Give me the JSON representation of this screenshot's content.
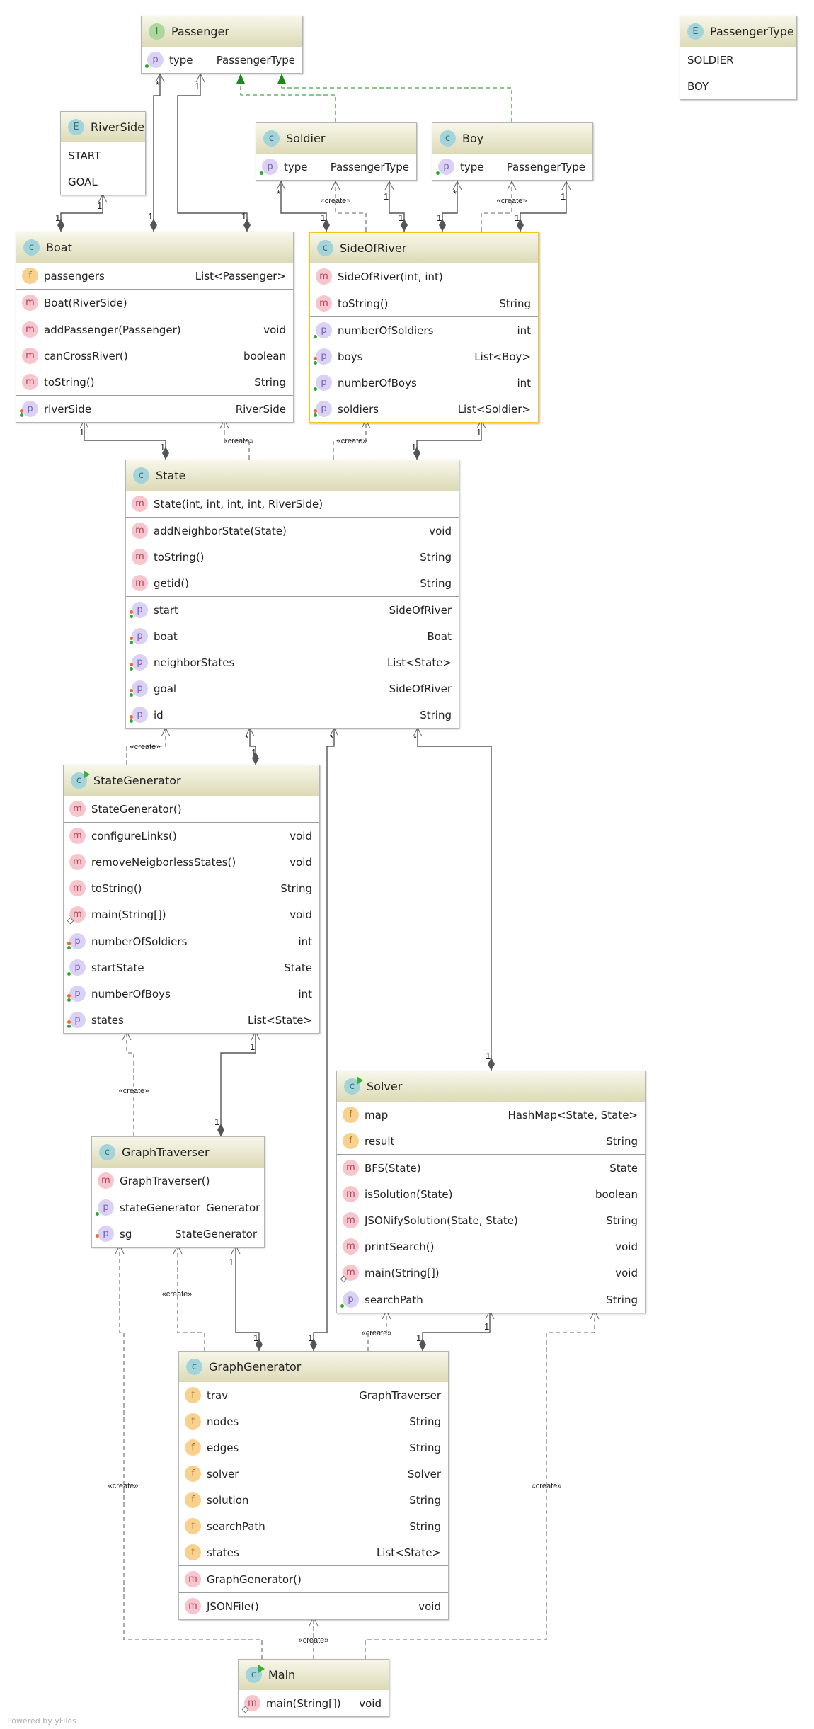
{
  "colors": {
    "header_top": "#f7f7ea",
    "header_bottom": "#dcdab6",
    "selection": "#f5c518",
    "realization": "#1a8a1a",
    "edge": "#555555"
  },
  "classes": [
    {
      "id": "passenger",
      "kind": "I",
      "name": "Passenger",
      "sections": [
        [
          {
            "icon": "p",
            "name": "type",
            "type": "PassengerType",
            "mods": [
              "g"
            ]
          }
        ]
      ]
    },
    {
      "id": "passengertype",
      "kind": "E",
      "name": "PassengerType",
      "enum": [
        "SOLDIER",
        "BOY"
      ]
    },
    {
      "id": "riverside",
      "kind": "E",
      "name": "RiverSide",
      "enum": [
        "START",
        "GOAL"
      ]
    },
    {
      "id": "soldier",
      "kind": "C",
      "name": "Soldier",
      "sections": [
        [
          {
            "icon": "p",
            "name": "type",
            "type": "PassengerType",
            "mods": [
              "g"
            ]
          }
        ]
      ]
    },
    {
      "id": "boy",
      "kind": "C",
      "name": "Boy",
      "sections": [
        [
          {
            "icon": "p",
            "name": "type",
            "type": "PassengerType",
            "mods": [
              "g"
            ]
          }
        ]
      ]
    },
    {
      "id": "boat",
      "kind": "C",
      "name": "Boat",
      "sections": [
        [
          {
            "icon": "f",
            "name": "passengers",
            "type": "List<Passenger>",
            "mods": []
          }
        ],
        [
          {
            "icon": "m",
            "name": "Boat(RiverSide)",
            "type": "",
            "mods": []
          }
        ],
        [
          {
            "icon": "m",
            "name": "addPassenger(Passenger)",
            "type": "void",
            "mods": []
          },
          {
            "icon": "m",
            "name": "canCrossRiver()",
            "type": "boolean",
            "mods": []
          },
          {
            "icon": "m",
            "name": "toString()",
            "type": "String",
            "mods": []
          }
        ],
        [
          {
            "icon": "p",
            "name": "riverSide",
            "type": "RiverSide",
            "mods": [
              "r",
              "g"
            ]
          }
        ]
      ]
    },
    {
      "id": "sideofriver",
      "kind": "C",
      "name": "SideOfRiver",
      "selected": true,
      "sections": [
        [
          {
            "icon": "m",
            "name": "SideOfRiver(int, int)",
            "type": "",
            "mods": []
          }
        ],
        [
          {
            "icon": "m",
            "name": "toString()",
            "type": "String",
            "mods": []
          }
        ],
        [
          {
            "icon": "p",
            "name": "numberOfSoldiers",
            "type": "int",
            "mods": [
              "g"
            ]
          },
          {
            "icon": "p",
            "name": "boys",
            "type": "List<Boy>",
            "mods": [
              "r",
              "g"
            ]
          },
          {
            "icon": "p",
            "name": "numberOfBoys",
            "type": "int",
            "mods": [
              "g"
            ]
          },
          {
            "icon": "p",
            "name": "soldiers",
            "type": "List<Soldier>",
            "mods": [
              "r",
              "g"
            ]
          }
        ]
      ]
    },
    {
      "id": "state",
      "kind": "C",
      "name": "State",
      "sections": [
        [
          {
            "icon": "m",
            "name": "State(int, int, int, int, RiverSide)",
            "type": "",
            "mods": []
          }
        ],
        [
          {
            "icon": "m",
            "name": "addNeighborState(State)",
            "type": "void",
            "mods": []
          },
          {
            "icon": "m",
            "name": "toString()",
            "type": "String",
            "mods": []
          },
          {
            "icon": "m",
            "name": "getid()",
            "type": "String",
            "mods": []
          }
        ],
        [
          {
            "icon": "p",
            "name": "start",
            "type": "SideOfRiver",
            "mods": [
              "r",
              "g"
            ]
          },
          {
            "icon": "p",
            "name": "boat",
            "type": "Boat",
            "mods": [
              "r",
              "g"
            ]
          },
          {
            "icon": "p",
            "name": "neighborStates",
            "type": "List<State>",
            "mods": [
              "r",
              "g"
            ]
          },
          {
            "icon": "p",
            "name": "goal",
            "type": "SideOfRiver",
            "mods": [
              "r",
              "g"
            ]
          },
          {
            "icon": "p",
            "name": "id",
            "type": "String",
            "mods": [
              "r",
              "g"
            ]
          }
        ]
      ]
    },
    {
      "id": "stategenerator",
      "kind": "C",
      "runnable": true,
      "name": "StateGenerator",
      "sections": [
        [
          {
            "icon": "m",
            "name": "StateGenerator()",
            "type": "",
            "mods": []
          }
        ],
        [
          {
            "icon": "m",
            "name": "configureLinks()",
            "type": "void",
            "mods": []
          },
          {
            "icon": "m",
            "name": "removeNeigborlessStates()",
            "type": "void",
            "mods": []
          },
          {
            "icon": "m",
            "name": "toString()",
            "type": "String",
            "mods": []
          },
          {
            "icon": "m",
            "name": "main(String[])",
            "type": "void",
            "mods": [
              "s"
            ]
          }
        ],
        [
          {
            "icon": "p",
            "name": "numberOfSoldiers",
            "type": "int",
            "mods": [
              "r",
              "g"
            ]
          },
          {
            "icon": "p",
            "name": "startState",
            "type": "State",
            "mods": [
              "g"
            ]
          },
          {
            "icon": "p",
            "name": "numberOfBoys",
            "type": "int",
            "mods": [
              "r",
              "g"
            ]
          },
          {
            "icon": "p",
            "name": "states",
            "type": "List<State>",
            "mods": [
              "r",
              "g"
            ]
          }
        ]
      ]
    },
    {
      "id": "solver",
      "kind": "C",
      "runnable": true,
      "name": "Solver",
      "sections": [
        [
          {
            "icon": "f",
            "name": "map",
            "type": "HashMap<State, State>",
            "mods": []
          },
          {
            "icon": "f",
            "name": "result",
            "type": "String",
            "mods": []
          }
        ],
        [
          {
            "icon": "m",
            "name": "BFS(State)",
            "type": "State",
            "mods": []
          },
          {
            "icon": "m",
            "name": "isSolution(State)",
            "type": "boolean",
            "mods": []
          },
          {
            "icon": "m",
            "name": "JSONifySolution(State, State)",
            "type": "String",
            "mods": []
          },
          {
            "icon": "m",
            "name": "printSearch()",
            "type": "void",
            "mods": []
          },
          {
            "icon": "m",
            "name": "main(String[])",
            "type": "void",
            "mods": [
              "s"
            ]
          }
        ],
        [
          {
            "icon": "p",
            "name": "searchPath",
            "type": "String",
            "mods": [
              "g"
            ]
          }
        ]
      ]
    },
    {
      "id": "graphtraverser",
      "kind": "C",
      "name": "GraphTraverser",
      "sections": [
        [
          {
            "icon": "m",
            "name": "GraphTraverser()",
            "type": "",
            "mods": []
          }
        ],
        [
          {
            "icon": "p",
            "name": "stateGenerator",
            "type": "Generator",
            "mods": [
              "g"
            ]
          },
          {
            "icon": "p",
            "name": "sg",
            "type": "StateGenerator",
            "mods": [
              "r"
            ]
          }
        ]
      ]
    },
    {
      "id": "graphgenerator",
      "kind": "C",
      "name": "GraphGenerator",
      "sections": [
        [
          {
            "icon": "f",
            "name": "trav",
            "type": "GraphTraverser",
            "mods": []
          },
          {
            "icon": "f",
            "name": "nodes",
            "type": "String",
            "mods": []
          },
          {
            "icon": "f",
            "name": "edges",
            "type": "String",
            "mods": []
          },
          {
            "icon": "f",
            "name": "solver",
            "type": "Solver",
            "mods": []
          },
          {
            "icon": "f",
            "name": "solution",
            "type": "String",
            "mods": []
          },
          {
            "icon": "f",
            "name": "searchPath",
            "type": "String",
            "mods": []
          },
          {
            "icon": "f",
            "name": "states",
            "type": "List<State>",
            "mods": []
          }
        ],
        [
          {
            "icon": "m",
            "name": "GraphGenerator()",
            "type": "",
            "mods": []
          }
        ],
        [
          {
            "icon": "m",
            "name": "JSONFile()",
            "type": "void",
            "mods": []
          }
        ]
      ]
    },
    {
      "id": "main",
      "kind": "C",
      "runnable": true,
      "name": "Main",
      "sections": [
        [
          {
            "icon": "m",
            "name": "main(String[])",
            "type": "void",
            "mods": [
              "s"
            ]
          }
        ]
      ]
    }
  ],
  "edges": [
    {
      "from": "Boat",
      "to": "Passenger",
      "kind": "composition",
      "labels": [
        "*",
        "1"
      ]
    },
    {
      "from": "Boat",
      "to": "Passenger",
      "kind": "composition",
      "labels": [
        "1",
        "1"
      ]
    },
    {
      "from": "Soldier",
      "to": "Passenger",
      "kind": "realization",
      "labels": []
    },
    {
      "from": "Boy",
      "to": "Passenger",
      "kind": "realization",
      "labels": []
    },
    {
      "from": "Boat",
      "to": "RiverSide",
      "kind": "composition",
      "labels": [
        "1",
        "1"
      ]
    },
    {
      "from": "SideOfRiver",
      "to": "Soldier",
      "kind": "composition",
      "labels": [
        "*",
        "1"
      ]
    },
    {
      "from": "SideOfRiver",
      "to": "Soldier",
      "kind": "create",
      "labels": [
        "«create»"
      ]
    },
    {
      "from": "SideOfRiver",
      "to": "Soldier",
      "kind": "composition",
      "labels": [
        "1",
        "1"
      ]
    },
    {
      "from": "SideOfRiver",
      "to": "Boy",
      "kind": "composition",
      "labels": [
        "*",
        "1"
      ]
    },
    {
      "from": "SideOfRiver",
      "to": "Boy",
      "kind": "create",
      "labels": [
        "«create»"
      ]
    },
    {
      "from": "SideOfRiver",
      "to": "Boy",
      "kind": "composition",
      "labels": [
        "1",
        "1"
      ]
    },
    {
      "from": "State",
      "to": "Boat",
      "kind": "composition",
      "labels": [
        "1",
        "1"
      ]
    },
    {
      "from": "State",
      "to": "Boat",
      "kind": "create",
      "labels": [
        "«create»"
      ]
    },
    {
      "from": "State",
      "to": "SideOfRiver",
      "kind": "create",
      "labels": [
        "«create»"
      ]
    },
    {
      "from": "State",
      "to": "SideOfRiver",
      "kind": "composition",
      "labels": [
        "1",
        "1"
      ]
    },
    {
      "from": "StateGenerator",
      "to": "State",
      "kind": "create",
      "labels": [
        "«create»"
      ]
    },
    {
      "from": "StateGenerator",
      "to": "State",
      "kind": "composition",
      "labels": [
        "*",
        "1"
      ]
    },
    {
      "from": "GraphGenerator",
      "to": "State",
      "kind": "composition",
      "labels": [
        "*",
        "1"
      ]
    },
    {
      "from": "Solver",
      "to": "State",
      "kind": "composition",
      "labels": [
        "*",
        "1"
      ]
    },
    {
      "from": "GraphTraverser",
      "to": "StateGenerator",
      "kind": "create",
      "labels": [
        "«create»"
      ]
    },
    {
      "from": "GraphTraverser",
      "to": "StateGenerator",
      "kind": "composition",
      "labels": [
        "1",
        "1"
      ]
    },
    {
      "from": "GraphGenerator",
      "to": "GraphTraverser",
      "kind": "create",
      "labels": [
        "«create»"
      ]
    },
    {
      "from": "GraphGenerator",
      "to": "GraphTraverser",
      "kind": "composition",
      "labels": [
        "1",
        "1"
      ]
    },
    {
      "from": "GraphGenerator",
      "to": "Solver",
      "kind": "create",
      "labels": [
        "«create»"
      ]
    },
    {
      "from": "GraphGenerator",
      "to": "Solver",
      "kind": "composition",
      "labels": [
        "1",
        "1"
      ]
    },
    {
      "from": "Main",
      "to": "GraphTraverser",
      "kind": "create",
      "labels": [
        "«create»"
      ]
    },
    {
      "from": "Main",
      "to": "GraphGenerator",
      "kind": "create",
      "labels": [
        "«create»"
      ]
    },
    {
      "from": "Main",
      "to": "Solver",
      "kind": "create",
      "labels": [
        "«create»"
      ]
    }
  ],
  "footer": "Powered by yFiles"
}
